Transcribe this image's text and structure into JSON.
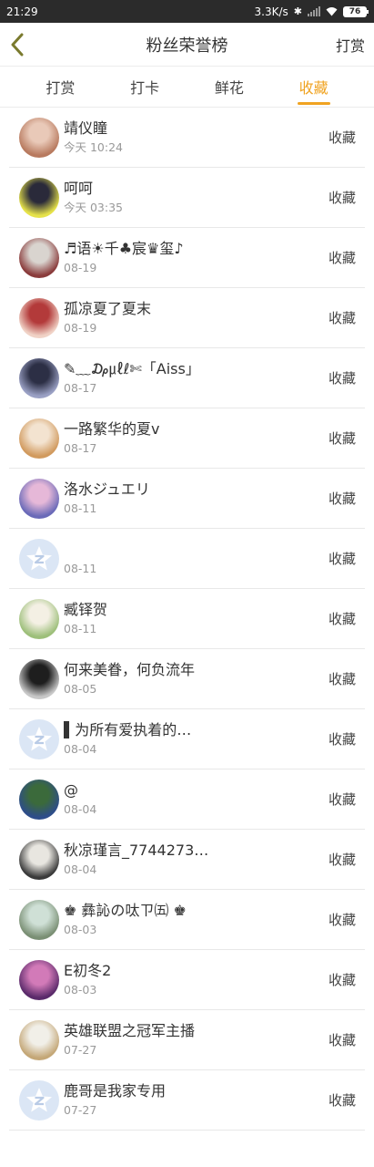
{
  "status": {
    "time": "21:29",
    "speed": "3.3K/s",
    "battery": "76"
  },
  "header": {
    "title": "粉丝荣誉榜",
    "right_label": "打赏"
  },
  "tabs": [
    {
      "label": "打赏",
      "active": false
    },
    {
      "label": "打卡",
      "active": false
    },
    {
      "label": "鲜花",
      "active": false
    },
    {
      "label": "收藏",
      "active": true
    }
  ],
  "rows": [
    {
      "name": "靖仪瞳",
      "date": "今天 10:24",
      "action": "收藏",
      "avatar": {
        "type": "photo",
        "colors": [
          "#e9c9b8",
          "#b87a5f"
        ]
      }
    },
    {
      "name": "呵呵",
      "date": "今天 03:35",
      "action": "收藏",
      "avatar": {
        "type": "photo",
        "colors": [
          "#2a2a3a",
          "#e6e24a"
        ]
      }
    },
    {
      "name": "♬语☀千♣宸♛玺♪",
      "date": "08-19",
      "action": "收藏",
      "avatar": {
        "type": "photo",
        "colors": [
          "#d9d4cf",
          "#8a3b3b"
        ]
      }
    },
    {
      "name": "孤凉夏了夏末",
      "date": "08-19",
      "action": "收藏",
      "avatar": {
        "type": "photo",
        "colors": [
          "#b33a3a",
          "#f0d2c6"
        ]
      }
    },
    {
      "name": "✎﹏₯㎕ℓ✄「Aiss」",
      "date": "08-17",
      "action": "收藏",
      "avatar": {
        "type": "photo",
        "colors": [
          "#2c2f45",
          "#9aa0c4"
        ]
      }
    },
    {
      "name": "一路繁华的夏v",
      "date": "08-17",
      "action": "收藏",
      "avatar": {
        "type": "photo",
        "colors": [
          "#f3e3d0",
          "#d19a5e"
        ]
      }
    },
    {
      "name": "洛水ジュエリ",
      "date": "08-11",
      "action": "收藏",
      "avatar": {
        "type": "photo",
        "colors": [
          "#e6b8d8",
          "#6a6ab8"
        ]
      }
    },
    {
      "name": "",
      "date": "08-11",
      "action": "收藏",
      "avatar": {
        "type": "default"
      }
    },
    {
      "name": "臧铎贺",
      "date": "08-11",
      "action": "收藏",
      "avatar": {
        "type": "photo",
        "colors": [
          "#f4f0e4",
          "#9dbf7a"
        ]
      }
    },
    {
      "name": "何来美眷，何负流年",
      "date": "08-05",
      "action": "收藏",
      "avatar": {
        "type": "photo",
        "colors": [
          "#1e1e1e",
          "#c8c8c8"
        ]
      }
    },
    {
      "name": "▌为所有爱执着的…",
      "date": "08-04",
      "action": "收藏",
      "avatar": {
        "type": "default"
      }
    },
    {
      "name": "@",
      "date": "08-04",
      "action": "收藏",
      "avatar": {
        "type": "photo",
        "colors": [
          "#3b6a3b",
          "#2e4d8a"
        ]
      }
    },
    {
      "name": "秋凉瑾言_7744273…",
      "date": "08-04",
      "action": "收藏",
      "avatar": {
        "type": "photo",
        "colors": [
          "#e8e6e0",
          "#3a3a3a"
        ]
      }
    },
    {
      "name": "♚ 彝訫の呔ㄗ㈤ ♚",
      "date": "08-03",
      "action": "收藏",
      "avatar": {
        "type": "photo",
        "colors": [
          "#cfe0d6",
          "#7a8f74"
        ]
      }
    },
    {
      "name": "E初冬2",
      "date": "08-03",
      "action": "收藏",
      "avatar": {
        "type": "photo",
        "colors": [
          "#d27ab8",
          "#5a2a6a"
        ]
      }
    },
    {
      "name": "英雄联盟之冠军主播",
      "date": "07-27",
      "action": "收藏",
      "avatar": {
        "type": "photo",
        "colors": [
          "#f1efe8",
          "#c4a777"
        ]
      }
    },
    {
      "name": "鹿哥是我家专用",
      "date": "07-27",
      "action": "收藏",
      "avatar": {
        "type": "default"
      }
    }
  ]
}
